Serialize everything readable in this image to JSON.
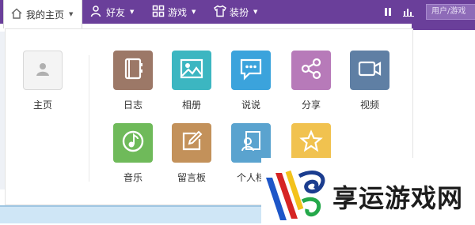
{
  "topbar": {
    "home_label": "我的主页",
    "friends_label": "好友",
    "games_label": "游戏",
    "dress_label": "装扮",
    "search_placeholder": "用户/游戏"
  },
  "apps": {
    "home": {
      "label": "主页"
    },
    "diary": {
      "label": "日志",
      "color": "#9c7867"
    },
    "album": {
      "label": "相册",
      "color": "#3cb6c1"
    },
    "talk": {
      "label": "说说",
      "color": "#3ba3dc"
    },
    "share": {
      "label": "分享",
      "color": "#b77ab9"
    },
    "video": {
      "label": "视频",
      "color": "#5f7fa4"
    },
    "music": {
      "label": "音乐",
      "color": "#6fba5a"
    },
    "board": {
      "label": "留言板",
      "color": "#c3915a"
    },
    "profile": {
      "label": "个人档",
      "color": "#5aa3cf"
    },
    "favorite": {
      "label": "收藏",
      "color": "#f1c24f"
    }
  },
  "watermark": {
    "text": "享运游戏网"
  },
  "colors": {
    "topbar": "#6a3f9a"
  }
}
